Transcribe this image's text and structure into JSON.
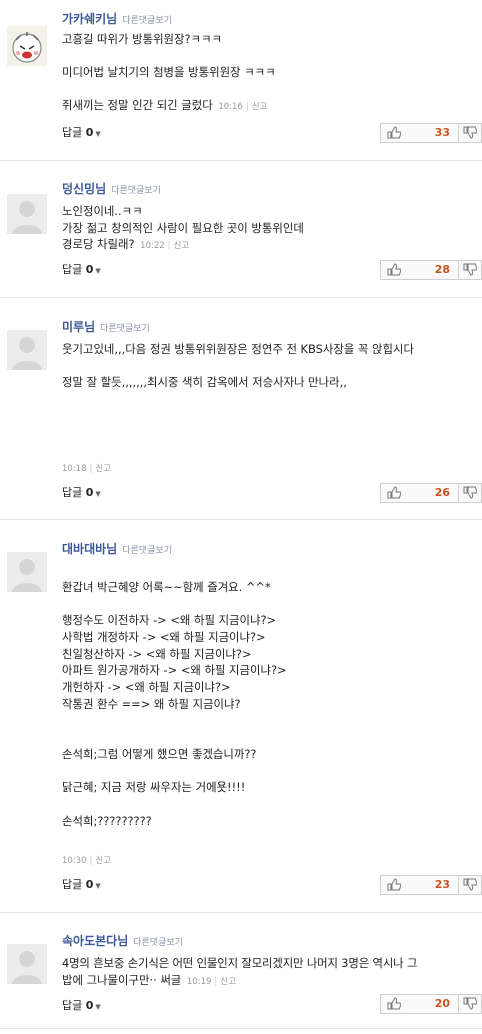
{
  "common": {
    "reply_link": "다른댓글보기",
    "report": "신고",
    "reply_label": "답글",
    "reply_count": "0"
  },
  "comments": [
    {
      "nickname": "가카쉐키님",
      "lines": [
        "고흥길 따위가 방통위원장?ㅋㅋㅋ",
        "",
        "미디어법 날치기의 첨병을 방통위원장 ㅋㅋㅋ",
        ""
      ],
      "last_line": "쥐새끼는 정말 인간 되긴 글렀다",
      "time": "10:16",
      "likes": "33"
    },
    {
      "nickname": "덩신밍님",
      "lines": [
        "노인정이네..ㅋㅋ",
        "가장 젊고 창의적인 사람이 필요한 곳이 방통위인데"
      ],
      "last_line": "경로당 차릴래?",
      "time": "10:22",
      "likes": "28"
    },
    {
      "nickname": "미루님",
      "lines": [
        "웃기고있네,,,다음 정권 방통위위원장은 정연주 전 KBS사장을 꼭 앉힙시다",
        "",
        "정말 잘 할듯,,,,,,,최시중 색히 감옥에서 저승사자나 만나라,,"
      ],
      "last_line": "",
      "time": "10:18",
      "likes": "26"
    },
    {
      "nickname": "대바대바님",
      "lines": [
        "",
        "환갑녀 박근혜양 어록~~함께 즐겨요. ^^*",
        "",
        "행정수도 이전하자 -> <왜 하필 지금이냐?>",
        "사학법 개정하자 -> <왜 하필 지금이냐?>",
        "친일청산하자 -> <왜 하필 지금이냐?>",
        "아파트 원가공개하자 -> <왜 하필 지금이냐?>",
        "개헌하자 -> <왜 하필 지금이냐?>",
        "작통권 환수 ==> 왜 하필 지금이냐?",
        "",
        "",
        "손석희;그럼 어떻게 했으면 좋겠습니까??",
        "",
        "닭근혜; 지금 저랑 싸우자는 거에욧!!!!",
        "",
        "손석희;?????????"
      ],
      "last_line": "",
      "time": "10:30",
      "likes": "23"
    },
    {
      "nickname": "속아도본다님",
      "lines": [
        "4명의 흔보중 손기식은 어떤 인물인지 잘모리겠지만 나머지 3명은 역시나 그"
      ],
      "last_line": "밥에 그나물이구만·· 써글",
      "time": "10:19",
      "likes": "20"
    }
  ]
}
